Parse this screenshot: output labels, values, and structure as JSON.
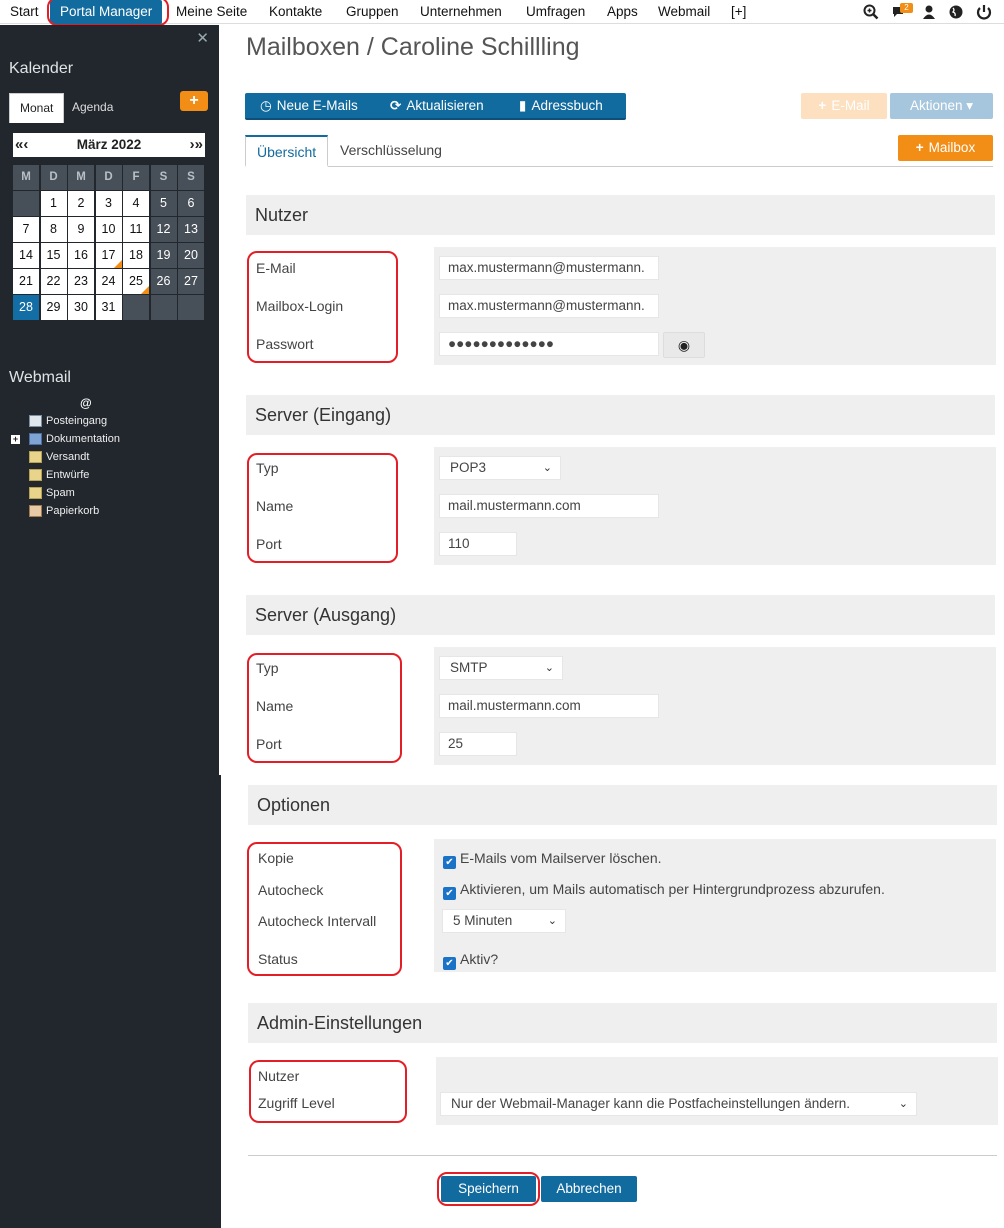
{
  "topnav": {
    "items": [
      "Start",
      "Portal Manager",
      "Meine Seite",
      "Kontakte",
      "Gruppen",
      "Unternehmen",
      "Umfragen",
      "Apps",
      "Webmail",
      "[+]"
    ],
    "notification_count": "2"
  },
  "sidebar": {
    "calendar_title": "Kalender",
    "tabs": [
      "Monat",
      "Agenda"
    ],
    "add_label": "+",
    "month_label": "März 2022",
    "prev_label": "«‹",
    "next_label": "›»",
    "weekdays": [
      "M",
      "D",
      "M",
      "D",
      "F",
      "S",
      "S"
    ],
    "weeks": [
      [
        "",
        "1",
        "2",
        "3",
        "4",
        "5",
        "6"
      ],
      [
        "7",
        "8",
        "9",
        "10",
        "11",
        "12",
        "13"
      ],
      [
        "14",
        "15",
        "16",
        "17",
        "18",
        "19",
        "20"
      ],
      [
        "21",
        "22",
        "23",
        "24",
        "25",
        "26",
        "27"
      ],
      [
        "28",
        "29",
        "30",
        "31",
        "",
        "",
        ""
      ]
    ],
    "today": "28",
    "event_days": [
      "17",
      "25"
    ],
    "webmail_title": "Webmail",
    "webmail_root": "@",
    "folders": [
      "Posteingang",
      "Dokumentation",
      "Versandt",
      "Entwürfe",
      "Spam",
      "Papierkorb"
    ]
  },
  "main": {
    "page_title": "Mailboxen / Caroline Schillling",
    "toolbar": {
      "new_emails": "Neue E-Mails",
      "refresh": "Aktualisieren",
      "addressbook": "Adressbuch",
      "email": "E-Mail",
      "actions": "Aktionen"
    },
    "tabs": [
      "Übersicht",
      "Verschlüsselung"
    ],
    "mailbox_button": "Mailbox",
    "nutzer": {
      "title": "Nutzer",
      "email_label": "E-Mail",
      "email_value": "max.mustermann@mustermann.",
      "login_label": "Mailbox-Login",
      "login_value": "max.mustermann@mustermann.",
      "password_label": "Passwort",
      "password_value": "●●●●●●●●●●●●●"
    },
    "server_in": {
      "title": "Server (Eingang)",
      "type_label": "Typ",
      "type_value": "POP3",
      "name_label": "Name",
      "name_value": "mail.mustermann.com",
      "port_label": "Port",
      "port_value": "110"
    },
    "server_out": {
      "title": "Server (Ausgang)",
      "type_label": "Typ",
      "type_value": "SMTP",
      "name_label": "Name",
      "name_value": "mail.mustermann.com",
      "port_label": "Port",
      "port_value": "25"
    },
    "options": {
      "title": "Optionen",
      "copy_label": "Kopie",
      "copy_text": "E-Mails vom Mailserver löschen.",
      "autocheck_label": "Autocheck",
      "autocheck_text": "Aktivieren, um Mails automatisch per Hintergrundprozess abzurufen.",
      "interval_label": "Autocheck Intervall",
      "interval_value": "5 Minuten",
      "status_label": "Status",
      "status_text": "Aktiv?"
    },
    "admin": {
      "title": "Admin-Einstellungen",
      "user_label": "Nutzer",
      "access_label": "Zugriff Level",
      "access_value": "Nur der Webmail-Manager kann die Postfacheinstellungen ändern."
    },
    "save_label": "Speichern",
    "cancel_label": "Abbrechen"
  }
}
